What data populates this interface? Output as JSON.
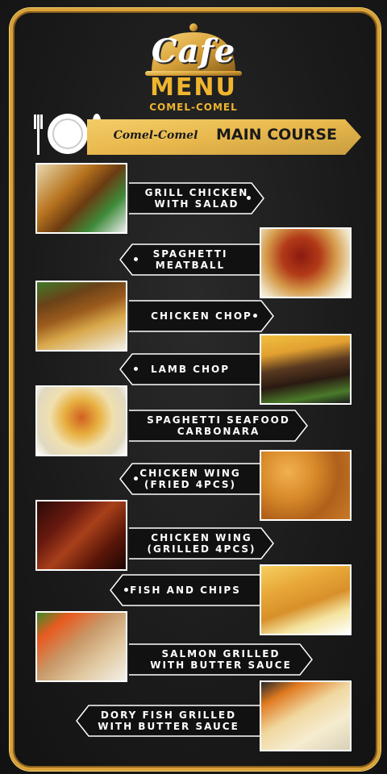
{
  "header": {
    "cafe": "Cafe",
    "menu": "MENU",
    "brand": "COMEL-COMEL"
  },
  "banner": {
    "brand": "Comel-Comel",
    "title": "MAIN COURSE"
  },
  "colors": {
    "gold": "#d9a23a",
    "board": "#1c1c1c",
    "tag_bg": "#111111",
    "tag_border": "#ffffff"
  },
  "items": [
    {
      "name": "GRILL CHICKEN\nWITH SALAD",
      "photo": "grilled-chicken-salad"
    },
    {
      "name": "SPAGHETTI\nMEATBALL",
      "photo": "spaghetti-meatball"
    },
    {
      "name": "CHICKEN CHOP",
      "photo": "chicken-chop"
    },
    {
      "name": "LAMB CHOP",
      "photo": "lamb-chop"
    },
    {
      "name": "SPAGHETTI SEAFOOD\nCARBONARA",
      "photo": "spaghetti-carbonara"
    },
    {
      "name": "CHICKEN WING\n(FRIED 4PCS)",
      "photo": "fried-chicken-wings"
    },
    {
      "name": "CHICKEN WING\n(GRILLED 4PCS)",
      "photo": "grilled-chicken-wings"
    },
    {
      "name": "FISH AND CHIPS",
      "photo": "fish-and-chips"
    },
    {
      "name": "SALMON GRILLED\nWITH BUTTER SAUCE",
      "photo": "grilled-salmon"
    },
    {
      "name": "DORY FISH GRILLED\nWITH BUTTER SAUCE",
      "photo": "grilled-dory-fish"
    }
  ]
}
